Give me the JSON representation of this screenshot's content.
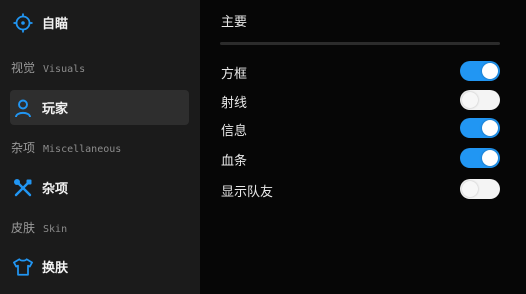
{
  "sidebar": {
    "aimbot": {
      "label": "自瞄",
      "icon": "crosshair-icon"
    },
    "visuals_section": {
      "cn": "视觉",
      "en": "Visuals"
    },
    "player": {
      "label": "玩家",
      "icon": "person-icon"
    },
    "misc_section": {
      "cn": "杂项",
      "en": "Miscellaneous"
    },
    "misc": {
      "label": "杂项",
      "icon": "tools-icon"
    },
    "skin_section": {
      "cn": "皮肤",
      "en": "Skin"
    },
    "skin": {
      "label": "换肤",
      "icon": "shirt-icon"
    },
    "active_item": "玩家"
  },
  "main": {
    "title": "主要",
    "options": [
      {
        "label": "方框",
        "enabled": true
      },
      {
        "label": "射线",
        "enabled": false
      },
      {
        "label": "信息",
        "enabled": true
      },
      {
        "label": "血条",
        "enabled": true
      },
      {
        "label": "显示队友",
        "enabled": false
      }
    ]
  },
  "colors": {
    "accent": "#2196f3",
    "sidebar_bg": "#1b1b1b",
    "main_bg": "#060606",
    "active_item_bg": "#2e2e2e"
  }
}
